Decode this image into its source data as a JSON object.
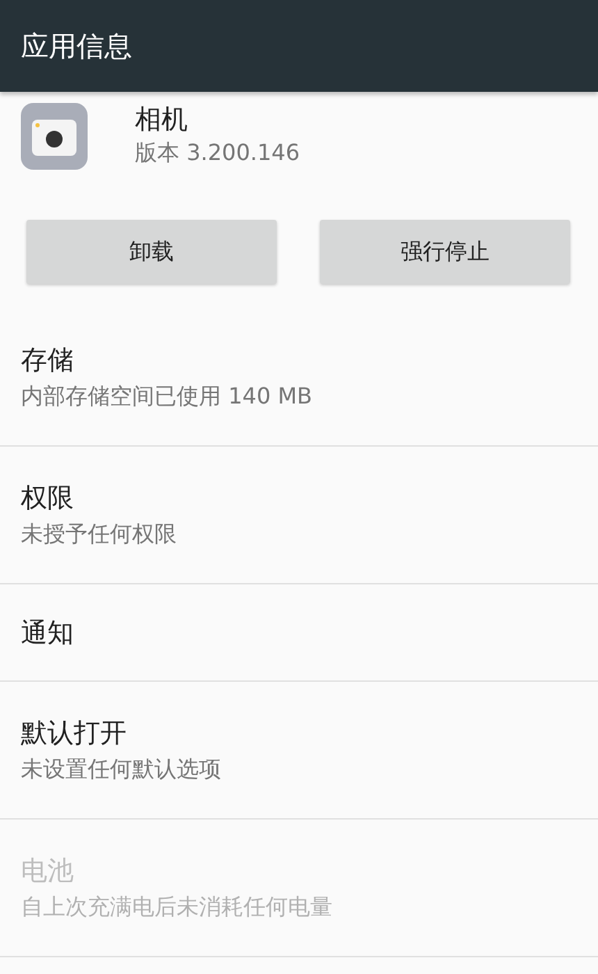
{
  "toolbar": {
    "title": "应用信息"
  },
  "app": {
    "name": "相机",
    "version": "版本 3.200.146"
  },
  "buttons": [
    {
      "label": "卸载"
    },
    {
      "label": "强行停止"
    }
  ],
  "settings": [
    {
      "title": "存储",
      "summary": "内部存储空间已使用 140 MB",
      "disabled": false
    },
    {
      "title": "权限",
      "summary": "未授予任何权限",
      "disabled": false
    },
    {
      "title": "通知",
      "disabled": false
    },
    {
      "title": "默认打开",
      "summary": "未设置任何默认选项",
      "disabled": false
    },
    {
      "title": "电池",
      "summary": "自上次充满电后未消耗任何电量",
      "disabled": true
    }
  ]
}
